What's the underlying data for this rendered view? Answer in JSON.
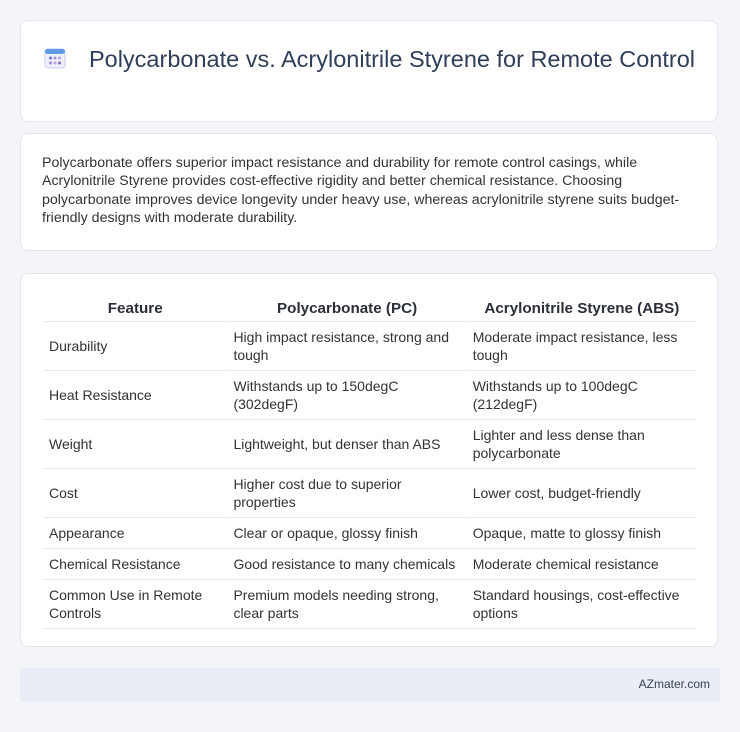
{
  "header": {
    "icon": "calendar-icon",
    "title": "Polycarbonate vs. Acrylonitrile Styrene for Remote Control"
  },
  "intro": {
    "text": "Polycarbonate offers superior impact resistance and durability for remote control casings, while Acrylonitrile Styrene provides cost-effective rigidity and better chemical resistance. Choosing polycarbonate improves device longevity under heavy use, whereas acrylonitrile styrene suits budget-friendly designs with moderate durability."
  },
  "table": {
    "headers": [
      "Feature",
      "Polycarbonate (PC)",
      "Acrylonitrile Styrene (ABS)"
    ],
    "rows": [
      [
        "Durability",
        "High impact resistance, strong and tough",
        "Moderate impact resistance, less tough"
      ],
      [
        "Heat Resistance",
        "Withstands up to 150degC (302degF)",
        "Withstands up to 100degC (212degF)"
      ],
      [
        "Weight",
        "Lightweight, but denser than ABS",
        "Lighter and less dense than polycarbonate"
      ],
      [
        "Cost",
        "Higher cost due to superior properties",
        "Lower cost, budget-friendly"
      ],
      [
        "Appearance",
        "Clear or opaque, glossy finish",
        "Opaque, matte to glossy finish"
      ],
      [
        "Chemical Resistance",
        "Good resistance to many chemicals",
        "Moderate chemical resistance"
      ],
      [
        "Common Use in Remote Controls",
        "Premium models needing strong, clear parts",
        "Standard housings, cost-effective options"
      ]
    ]
  },
  "footer": {
    "brand": "AZmater.com"
  },
  "colors": {
    "background": "#f3f5f9",
    "title": "#2f3e59",
    "footer_bg": "#e8edf6",
    "icon_purple": "#7d6fd6",
    "icon_blue": "#5d9be8"
  }
}
